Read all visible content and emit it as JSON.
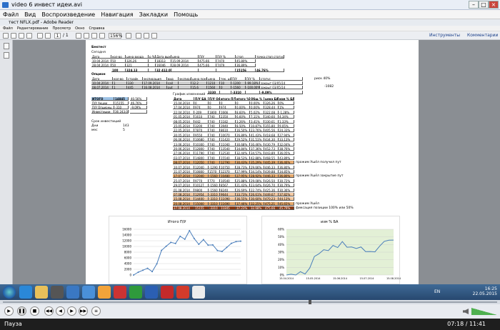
{
  "player": {
    "title": "video 6 инвест идеи.avi",
    "menu": [
      "Файл",
      "Вид",
      "Воспроизведение",
      "Навигация",
      "Закладки",
      "Помощь"
    ],
    "status": "Пауза",
    "time": "07:18 / 11:41"
  },
  "reader": {
    "title": "тест NFLX.pdf - Adobe Reader",
    "menu": [
      "Файл",
      "Редактирование",
      "Просмотр",
      "Окно",
      "Справка"
    ],
    "page_current": "1",
    "page_total": "/ 1",
    "zoom": "156%",
    "tools": "Инструменты",
    "comments": "Комментарии"
  },
  "doc": {
    "backtest": "Бектест",
    "today": "Сегодня",
    "trades_header": [
      "Дата",
      "кол-во",
      "цена входа",
      "р %",
      "Дата выхода",
      "цена",
      "П/У",
      "П/У %",
      "стоп",
      "точка стоп статус"
    ],
    "trades": [
      [
        "10.04.2014",
        "50",
        "326,26",
        "",
        "18313",
        "15.09.2014",
        "475,66",
        "7470",
        "45,80%"
      ],
      [
        "28.04.2014",
        "50",
        "321",
        "",
        "16046",
        "28.09.2014",
        "475,66",
        "7479",
        "36,89%"
      ]
    ],
    "trades_total": [
      "100",
      "324,13",
      "",
      "32 412,00",
      "",
      "",
      "",
      "15156",
      "46,76%"
    ],
    "options_label": "Опцион",
    "options_header": [
      "Дата",
      "кол-во",
      "страйк",
      "экспирация",
      "вид",
      "экспирация",
      "цена покупки",
      "цена",
      "тек. цена",
      "П/У",
      "П/У %",
      "статус"
    ],
    "options": [
      [
        "10.04.2014",
        "1",
        "330",
        "17.09.2014",
        "call",
        "",
        "12,2",
        "1210",
        "10",
        "-1200",
        "-99,18%",
        "закрыт 03/05/14"
      ],
      [
        "08.07.2014",
        "1",
        "445",
        "16.08.2014",
        "put",
        "",
        "15,6",
        "1560",
        "0",
        "-1560",
        "-100,00%",
        "закрыт 03/05/14"
      ]
    ],
    "options_total": [
      "3330",
      "",
      "-3310",
      "",
      "-9,09%"
    ],
    "risk_note": "риск 40%",
    "minus_note": "-1082",
    "summary": [
      {
        "label": "ИТОГО",
        "value": "14845",
        "pct": "40,56%"
      },
      {
        "label": "П/У Акции",
        "value": "15155",
        "pct": "46,76%"
      },
      {
        "label": "П/У Опционы",
        "value": "-310",
        "pct": "-9,09%"
      },
      {
        "label": "Инвестиции",
        "value": "36 243,00",
        "pct": ""
      }
    ],
    "invest_term": "Срок инвестиций",
    "days_label": "Дни",
    "days": "143",
    "months_label": "мес",
    "months": "5",
    "changes_title": "График изменений",
    "changes_header": [
      "Дата",
      "П/У БА",
      "П/У Оп",
      "итого П/У",
      "итого %",
      "Общ %",
      "цена БА",
      "изм % БА"
    ],
    "changes": [
      [
        "15.04.2014",
        "0",
        "0",
        "0",
        "0",
        "0,00%",
        "326,26",
        "0%"
      ],
      [
        "17.04.2014",
        "974",
        "0",
        "974",
        "0,00%",
        "0,00%",
        "328,44",
        "1%"
      ],
      [
        "22.04.2014",
        "-209",
        "1800",
        "1666",
        "8,60%",
        "5,02%",
        "322,08",
        "-1,28%"
      ],
      [
        "01.05.2014",
        "1610",
        "740",
        "2350",
        "6,60%",
        "7,11%",
        "340,60",
        "4,34%"
      ],
      [
        "08.05.2014",
        "442",
        "740",
        "1182",
        "3,26%",
        "3,41%",
        "330,61",
        "1,33%"
      ],
      [
        "15.05.2014",
        "3200",
        "740",
        "3940",
        "8,50%",
        "10,87%",
        "355,80",
        "9,05%"
      ],
      [
        "22.05.2014",
        "7870",
        "740",
        "8610",
        "16,50%",
        "23,76%",
        "405,56",
        "24,33%"
      ],
      [
        "30.05.2014",
        "9550",
        "740",
        "10070",
        "26,89%",
        "41,43%",
        "418,68",
        "27,94%"
      ],
      [
        "06.06.2014",
        "10680",
        "740",
        "11420",
        "29,52%",
        "31,51%",
        "434,30",
        "33,13%"
      ],
      [
        "13.06.2014",
        "10300",
        "740",
        "11040",
        "30,68%",
        "30,46%",
        "430,79",
        "32,04%"
      ],
      [
        "20.06.2014",
        "12800",
        "740",
        "13540",
        "34,84%",
        "37,36%",
        "452,73",
        "38,76%"
      ],
      [
        "27.06.2014",
        "11790",
        "740",
        "12530",
        "32,44%",
        "34,57%",
        "443,89",
        "36,05%"
      ],
      [
        "03.07.2014",
        "14800",
        "740",
        "15540",
        "38,53%",
        "42,88%",
        "468,55",
        "43,89%"
      ],
      [
        "08.07.2014",
        "12050",
        "740",
        "12790",
        "30,43%",
        "35,29%",
        "445,39",
        "36,46%"
      ],
      [
        "10.07.2014",
        "12040",
        "-1290",
        "10750",
        "28,73%",
        "29,66%",
        "446,33",
        "36,80%"
      ],
      [
        "11.07.2014",
        "10800",
        "1570",
        "12370",
        "27,99%",
        "34,14%",
        "439,88",
        "34,85%"
      ],
      [
        "17.07.2014",
        "12040",
        "-1560",
        "10480",
        "27,95%",
        "28,92%",
        "446,33",
        "36,80%"
      ],
      [
        "25.07.2014",
        "9770",
        "770",
        "10540",
        "25,88%",
        "29,08%",
        "426,50",
        "30,72%"
      ],
      [
        "29.07.2014",
        "10127",
        "-1560",
        "8567",
        "21,43%",
        "23,64%",
        "426,70",
        "30,79%"
      ],
      [
        "01.08.2014",
        "9800",
        "-1560",
        "8240",
        "26,69%",
        "22,74%",
        "425,36",
        "30,36%"
      ],
      [
        "07.08.2014",
        "12954",
        "-3310",
        "9644",
        "33,73%",
        "26,61%",
        "449,67",
        "37,82%"
      ],
      [
        "15.08.2014",
        "14400",
        "-3310",
        "11090",
        "36,55%",
        "30,60%",
        "470,23",
        "44,13%"
      ],
      [
        "20.08.2014",
        "15000",
        "-3310",
        "11690",
        "37,46%",
        "32,25%",
        "475,21",
        "45,65%"
      ],
      [
        "27.08.2014",
        "15155",
        "-3310",
        "11845",
        "37,23%",
        "32,68%",
        "475,66",
        "45,79%"
      ]
    ],
    "notes": {
      "r13": "прожим  Ушёл получил пут",
      "r16": "прожим  Ушёл закрытие пут",
      "r22": "прожим  Ушёл",
      "r23": "фиксация позиции 100% или 50%"
    },
    "chart1_title": "Итого П/У",
    "chart2_title": "изм % БА"
  },
  "chart_data": [
    {
      "type": "line",
      "title": "Итого П/У",
      "ylim": [
        0,
        16000
      ],
      "yticks": [
        "16000",
        "14000",
        "12000",
        "10000",
        "8000",
        "6000",
        "4000",
        "2000",
        "0"
      ],
      "values": [
        0,
        974,
        1666,
        2350,
        1182,
        3940,
        8610,
        10070,
        11420,
        11040,
        13540,
        12530,
        15540,
        12790,
        10750,
        12370,
        10480,
        10540,
        8567,
        8240,
        9644,
        11090,
        11690,
        11845
      ],
      "color": "#4a7ebb"
    },
    {
      "type": "line",
      "title": "изм % БА",
      "ylim": [
        0,
        60
      ],
      "yticks": [
        "60%",
        "50%",
        "40%",
        "30%",
        "20%",
        "10%",
        "0%"
      ],
      "xticks": [
        "15.04.2014",
        "15.05.2014",
        "15.06.2014",
        "15.07.2014",
        "15.08.2014"
      ],
      "values": [
        0,
        1,
        -1.28,
        4.34,
        1.33,
        9.05,
        24.33,
        27.94,
        33.13,
        32.04,
        38.76,
        36.05,
        43.89,
        36.46,
        36.8,
        34.85,
        36.8,
        30.72,
        30.79,
        30.36,
        37.82,
        44.13,
        45.65,
        45.79
      ],
      "color": "#4a7ebb",
      "bg": "#e3f0d6"
    }
  ],
  "taskbar": {
    "lang": "EN",
    "time": "16:25",
    "date": "22.05.2015"
  }
}
